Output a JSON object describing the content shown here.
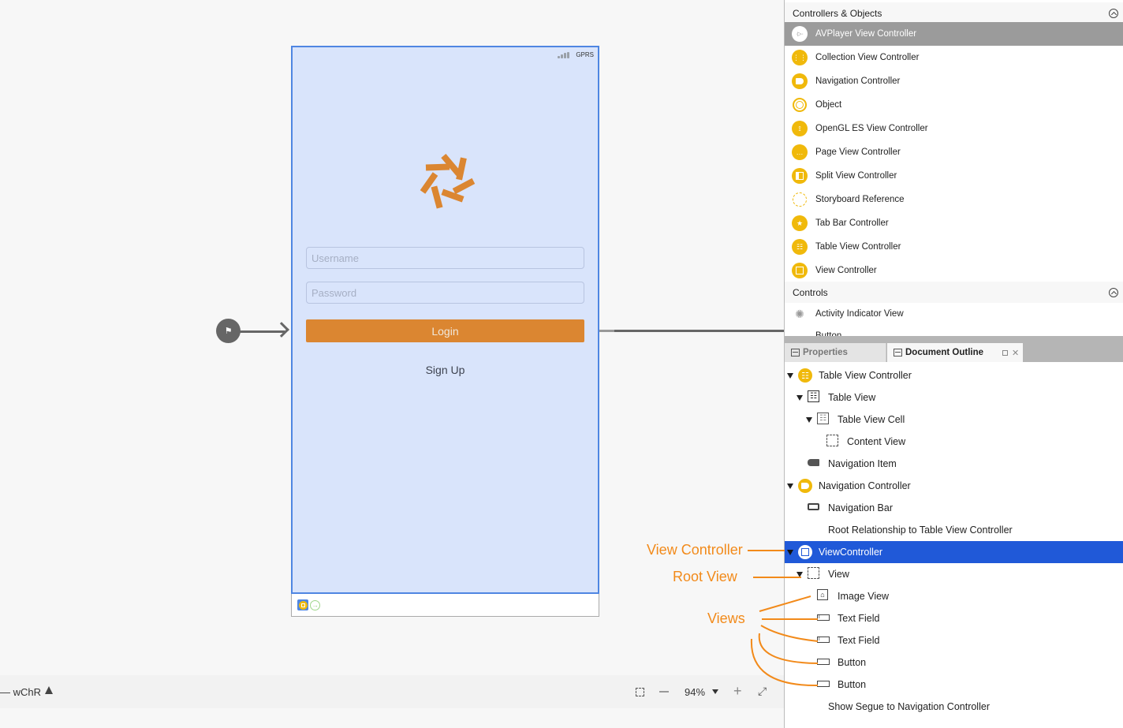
{
  "canvas": {
    "status_bar": {
      "carrier": "GPRS"
    },
    "username_placeholder": "Username",
    "password_placeholder": "Password",
    "login_label": "Login",
    "signup_label": "Sign Up",
    "colors": {
      "scene_bg": "#d9e4fb",
      "scene_border": "#4f86e2",
      "login_bg": "#db8631",
      "logo": "#db8631"
    }
  },
  "bottom_bar": {
    "device_config": "— wChR",
    "zoom_level": "94%"
  },
  "library": {
    "sections": [
      {
        "title": "Controllers & Objects",
        "items": [
          {
            "label": "AVPlayer View Controller",
            "icon": "avplayer-icon",
            "selected": true
          },
          {
            "label": "Collection View Controller",
            "icon": "collection-grid-icon"
          },
          {
            "label": "Navigation Controller",
            "icon": "navigation-icon"
          },
          {
            "label": "Object",
            "icon": "object-ring-icon"
          },
          {
            "label": "OpenGL ES View Controller",
            "icon": "opengl-icon"
          },
          {
            "label": "Page View Controller",
            "icon": "page-dots-icon"
          },
          {
            "label": "Split View Controller",
            "icon": "split-view-icon"
          },
          {
            "label": "Storyboard Reference",
            "icon": "storyboard-reference-icon"
          },
          {
            "label": "Tab Bar Controller",
            "icon": "tab-bar-icon"
          },
          {
            "label": "Table View Controller",
            "icon": "table-icon"
          },
          {
            "label": "View Controller",
            "icon": "view-controller-icon"
          }
        ]
      },
      {
        "title": "Controls",
        "items": [
          {
            "label": "Activity Indicator View",
            "icon": "activity-indicator-icon"
          },
          {
            "label": "Button",
            "icon": "button-icon"
          }
        ]
      }
    ]
  },
  "tabs": {
    "properties": "Properties",
    "document_outline": "Document Outline",
    "active": "Document Outline"
  },
  "outline": [
    {
      "label": "Table View Controller",
      "depth": 0,
      "expanded": true,
      "icon": "table-view-controller-icon"
    },
    {
      "label": "Table View",
      "depth": 1,
      "expanded": true,
      "icon": "table-view-icon"
    },
    {
      "label": "Table View Cell",
      "depth": 2,
      "expanded": true,
      "icon": "table-view-cell-icon"
    },
    {
      "label": "Content View",
      "depth": 3,
      "icon": "content-view-icon"
    },
    {
      "label": "Navigation Item",
      "depth": 1,
      "icon": "navigation-item-icon"
    },
    {
      "label": "Navigation Controller",
      "depth": 0,
      "expanded": true,
      "icon": "navigation-controller-icon"
    },
    {
      "label": "Navigation Bar",
      "depth": 1,
      "icon": "navigation-bar-icon"
    },
    {
      "label": "Root Relationship to Table View Controller",
      "depth": 1,
      "icon": ""
    },
    {
      "label": "ViewController",
      "depth": 0,
      "expanded": true,
      "icon": "view-controller-icon",
      "selected": true
    },
    {
      "label": "View",
      "depth": 1,
      "expanded": true,
      "icon": "view-icon"
    },
    {
      "label": "Image View",
      "depth": 2,
      "icon": "image-view-icon"
    },
    {
      "label": "Text Field",
      "depth": 2,
      "icon": "text-field-icon"
    },
    {
      "label": "Text Field",
      "depth": 2,
      "icon": "text-field-icon"
    },
    {
      "label": "Button",
      "depth": 2,
      "icon": "button-icon"
    },
    {
      "label": "Button",
      "depth": 2,
      "icon": "button-icon"
    },
    {
      "label": "Show Segue to Navigation Controller",
      "depth": 1,
      "icon": ""
    }
  ],
  "annotations": {
    "view_controller": "View Controller",
    "root_view": "Root View",
    "views": "Views",
    "color": "#f28a1a"
  }
}
